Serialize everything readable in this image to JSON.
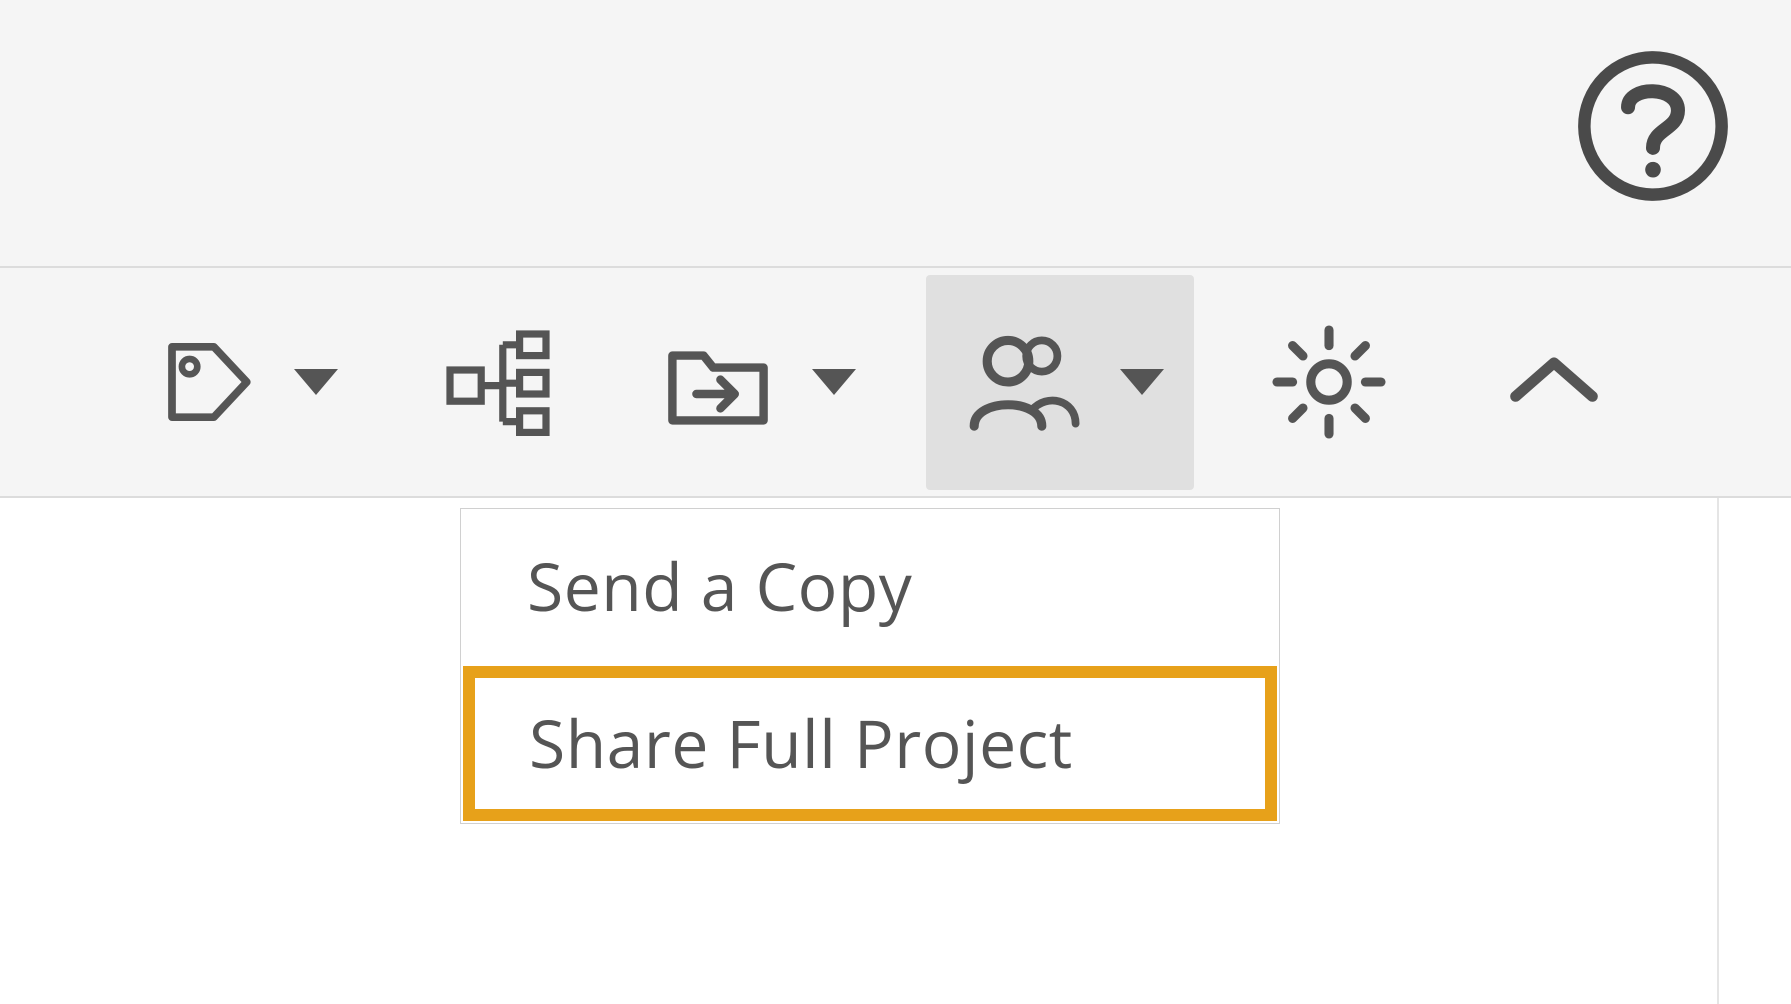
{
  "header": {
    "help_label": "Help"
  },
  "toolbar": {
    "tag_label": "Tags",
    "hierarchy_label": "Hierarchy",
    "move_label": "Move To",
    "share_label": "Share",
    "settings_label": "Settings",
    "collapse_label": "Collapse"
  },
  "share_menu": {
    "items": [
      {
        "label": "Send a Copy",
        "highlight": false
      },
      {
        "label": "Share Full Project",
        "highlight": true
      }
    ]
  },
  "colors": {
    "highlight_border": "#e7a11a",
    "icon_stroke": "#555555"
  }
}
